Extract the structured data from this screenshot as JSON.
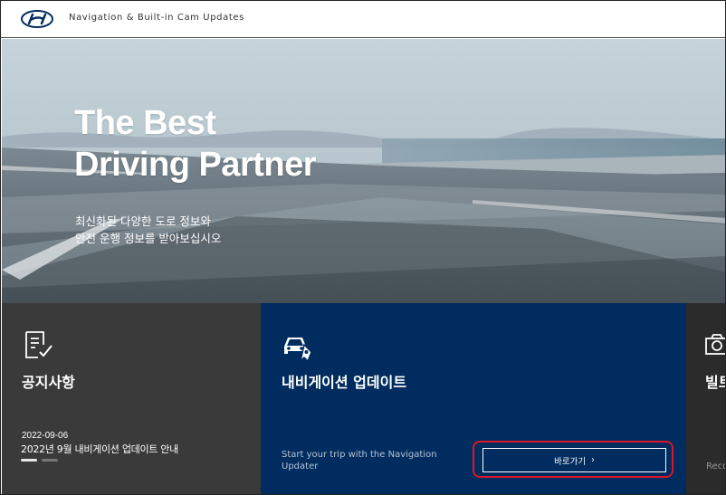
{
  "header": {
    "title": "Navigation & Built-in Cam Updates",
    "logo_icon": "hyundai-logo"
  },
  "hero": {
    "title_line1": "The Best",
    "title_line2": "Driving Partner",
    "subtitle_line1": "최신화된 다양한 도로 정보와",
    "subtitle_line2": "안전 운행 정보를 받아보십시오"
  },
  "cards": {
    "notice": {
      "icon": "notice-document-icon",
      "title": "공지사항",
      "date": "2022-09-06",
      "text": "2022년 9월 내비게이션 업데이트 안내",
      "slides": 2,
      "active_slide": 1
    },
    "navigation": {
      "icon": "car-navigation-icon",
      "title": "내비게이션 업데이트",
      "description": "Start your trip with the Navigation Updater",
      "button_label": "바로가기",
      "button_arrow": "›"
    },
    "cam": {
      "icon": "camera-icon",
      "title": "빌트",
      "description": "Reco"
    }
  },
  "colors": {
    "notice_bg": "#3a3a3a",
    "navigation_bg": "#002c5f",
    "cam_bg": "#2b2b2b",
    "highlight": "#d8182a"
  }
}
